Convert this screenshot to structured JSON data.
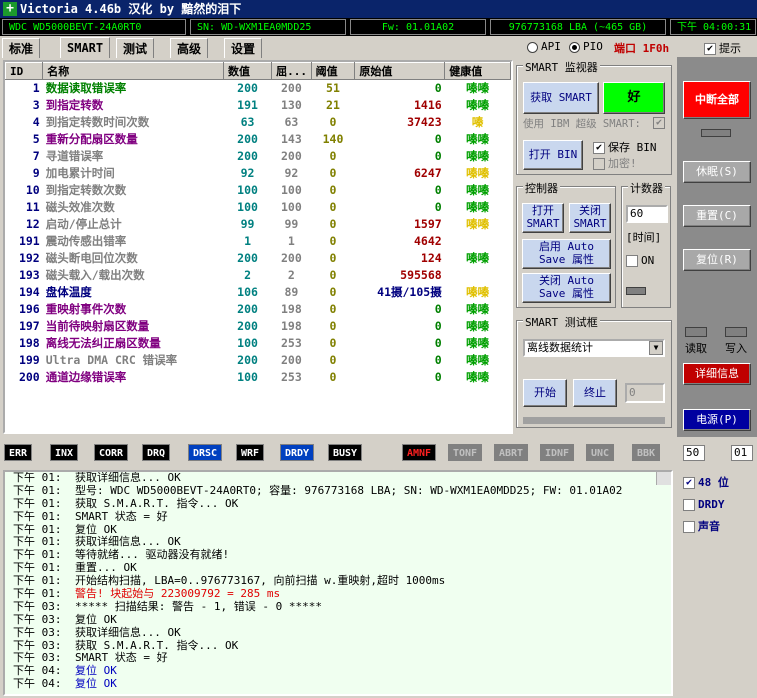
{
  "title": "Victoria 4.46b 汉化 by 黯然的泪下",
  "info": {
    "model": "WDC WD5000BEVT-24A0RT0",
    "sn": "SN: WD-WXM1EA0MDD25",
    "fw": "Fw: 01.01A02",
    "lba": "976773168 LBA (~465 GB)",
    "time": "下午 04:00:31"
  },
  "tabs": [
    "标准",
    "SMART",
    "测试",
    "高级",
    "设置"
  ],
  "modes": {
    "api": "API",
    "pio": "PIO",
    "port": "端口 1F0h",
    "hint": "提示"
  },
  "cols": [
    "ID",
    "名称",
    "数值",
    "屈...",
    "阈值",
    "原始值",
    "健康值"
  ],
  "rows": [
    {
      "id": "1",
      "name": "数据读取错误率",
      "val": "200",
      "w": "200",
      "t": "51",
      "raw": "0",
      "h": "嗪嗪",
      "c": "#008000"
    },
    {
      "id": "3",
      "name": "到指定转数",
      "val": "191",
      "w": "130",
      "t": "21",
      "raw": "1416",
      "h": "嗪嗪",
      "c": "#800080"
    },
    {
      "id": "4",
      "name": "到指定转数时间次数",
      "val": "63",
      "w": "63",
      "t": "0",
      "raw": "37423",
      "h": "嗪",
      "c": "#808080"
    },
    {
      "id": "5",
      "name": "重新分配扇区数量",
      "val": "200",
      "w": "143",
      "t": "140",
      "raw": "0",
      "h": "嗪嗪",
      "c": "#800080"
    },
    {
      "id": "7",
      "name": "寻道错误率",
      "val": "200",
      "w": "200",
      "t": "0",
      "raw": "0",
      "h": "嗪嗪",
      "c": "#808080"
    },
    {
      "id": "9",
      "name": "加电累计时间",
      "val": "92",
      "w": "92",
      "t": "0",
      "raw": "6247",
      "h": "嗪嗪",
      "c": "#808080"
    },
    {
      "id": "10",
      "name": "到指定转数次数",
      "val": "100",
      "w": "100",
      "t": "0",
      "raw": "0",
      "h": "嗪嗪",
      "c": "#808080"
    },
    {
      "id": "11",
      "name": "磁头效准次数",
      "val": "100",
      "w": "100",
      "t": "0",
      "raw": "0",
      "h": "嗪嗪",
      "c": "#808080"
    },
    {
      "id": "12",
      "name": "启动/停止总计",
      "val": "99",
      "w": "99",
      "t": "0",
      "raw": "1597",
      "h": "嗪嗪",
      "c": "#808080"
    },
    {
      "id": "191",
      "name": "震动传感出错率",
      "val": "1",
      "w": "1",
      "t": "0",
      "raw": "4642",
      "h": "",
      "c": "#808080"
    },
    {
      "id": "192",
      "name": "磁头断电回位次数",
      "val": "200",
      "w": "200",
      "t": "0",
      "raw": "124",
      "h": "嗪嗪",
      "c": "#808080"
    },
    {
      "id": "193",
      "name": "磁头载入/载出次数",
      "val": "2",
      "w": "2",
      "t": "0",
      "raw": "595568",
      "h": "",
      "c": "#808080"
    },
    {
      "id": "194",
      "name": "盘体温度",
      "val": "106",
      "w": "89",
      "t": "0",
      "raw": "41摄/105摄",
      "h": "嗪嗪",
      "c": "#00007f"
    },
    {
      "id": "196",
      "name": "重映射事件次数",
      "val": "200",
      "w": "198",
      "t": "0",
      "raw": "0",
      "h": "嗪嗪",
      "c": "#800080"
    },
    {
      "id": "197",
      "name": "当前待映射扇区数量",
      "val": "200",
      "w": "198",
      "t": "0",
      "raw": "0",
      "h": "嗪嗪",
      "c": "#800080"
    },
    {
      "id": "198",
      "name": "离线无法纠正扇区数量",
      "val": "100",
      "w": "253",
      "t": "0",
      "raw": "0",
      "h": "嗪嗪",
      "c": "#800080"
    },
    {
      "id": "199",
      "name": "Ultra DMA CRC 错误率",
      "val": "200",
      "w": "200",
      "t": "0",
      "raw": "0",
      "h": "嗪嗪",
      "c": "#808080"
    },
    {
      "id": "200",
      "name": "通道边缘错误率",
      "val": "100",
      "w": "253",
      "t": "0",
      "raw": "0",
      "h": "嗪嗪",
      "c": "#800080"
    }
  ],
  "smart": {
    "label": "SMART 监视器",
    "get": "获取 SMART",
    "good": "好",
    "ibm": "使用 IBM 超级 SMART:",
    "open": "打开 BIN",
    "save": "保存 BIN",
    "encrypt": "加密!"
  },
  "ctrl": {
    "label": "控制器",
    "open": "打开 SMART",
    "close": "关闭 SMART",
    "enable": "启用 Auto Save 属性",
    "disable": "关闭 Auto Save 属性"
  },
  "counter": {
    "label": "计数器",
    "value": "60",
    "unit": "[时间]",
    "on": "ON"
  },
  "test": {
    "label": "SMART 测试框",
    "option": "离线数据统计",
    "start": "开始",
    "stop": "终止",
    "value": "0"
  },
  "side": {
    "abort": "中断全部",
    "sleep": "休眠(S)",
    "reset": "重置(C)",
    "restore": "复位(R)",
    "read": "读取",
    "write": "写入",
    "details": "详细信息",
    "power": "电源(P)"
  },
  "status": [
    "ERR",
    "INX",
    "CORR",
    "DRQ",
    "DRSC",
    "WRF",
    "DRDY",
    "BUSY",
    "AMNF",
    "TONF",
    "ABRT",
    "IDNF",
    "UNC",
    "BBK"
  ],
  "status_nums": [
    "50",
    "01"
  ],
  "opts": {
    "bits": "48 位",
    "drdy": "DRDY",
    "sound": "声音"
  },
  "log": [
    {
      "t": "下午 01:",
      "m": "获取详细信息... OK"
    },
    {
      "t": "下午 01:",
      "m": "型号: WDC WD5000BEVT-24A0RT0;    容量: 976773168 LBA; SN: WD-WXM1EA0MDD25; FW: 01.01A02"
    },
    {
      "t": "下午 01:",
      "m": "获取 S.M.A.R.T. 指令... OK"
    },
    {
      "t": "下午 01:",
      "m": "SMART 状态 = 好"
    },
    {
      "t": "下午 01:",
      "m": "复位 OK"
    },
    {
      "t": "下午 01:",
      "m": "获取详细信息... OK"
    },
    {
      "t": "下午 01:",
      "m": "等待就绪... 驱动器没有就绪!"
    },
    {
      "t": "下午 01:",
      "m": "重置... OK"
    },
    {
      "t": "下午 01:",
      "m": "开始结构扫描, LBA=0..976773167, 向前扫描 w.重映射,超时 1000ms"
    },
    {
      "t": "下午 01:",
      "m": "警告! 块起始与 223009792 = 285 ms",
      "red": true
    },
    {
      "t": "下午 03:",
      "m": "***** 扫描结果: 警告 - 1, 错误 - 0 *****"
    },
    {
      "t": "下午 03:",
      "m": "复位 OK"
    },
    {
      "t": "下午 03:",
      "m": "获取详细信息... OK"
    },
    {
      "t": "下午 03:",
      "m": "获取 S.M.A.R.T. 指令... OK"
    },
    {
      "t": "下午 03:",
      "m": "SMART 状态 = 好"
    },
    {
      "t": "下午 04:",
      "m": "复位 OK",
      "blue": true
    },
    {
      "t": "下午 04:",
      "m": "复位 OK",
      "blue": true
    }
  ]
}
